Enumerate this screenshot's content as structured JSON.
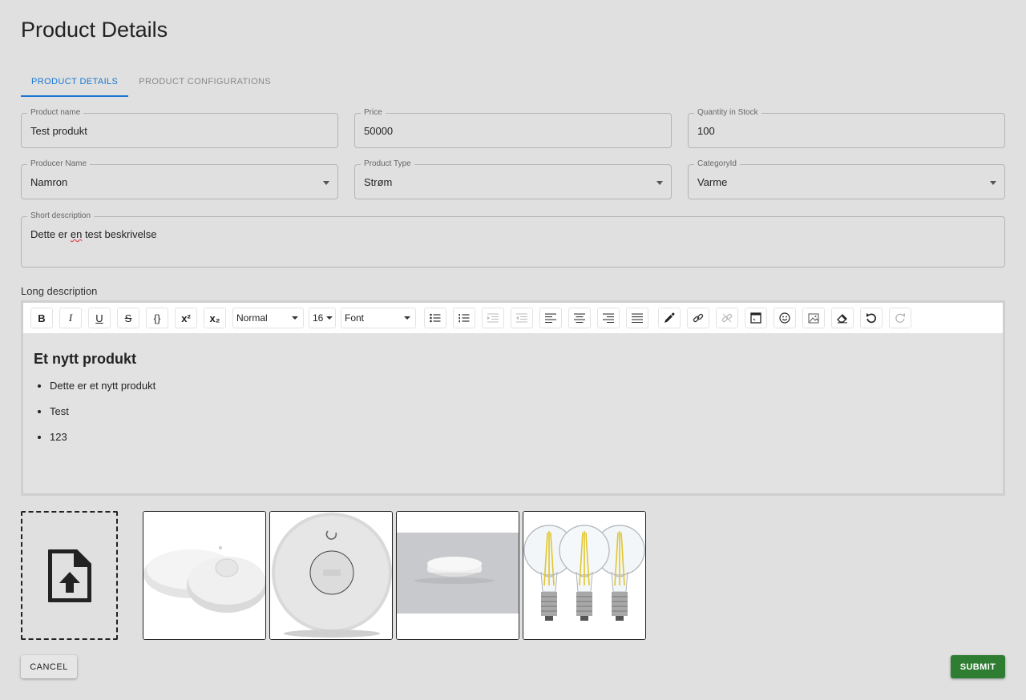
{
  "page": {
    "title": "Product Details"
  },
  "tabs": [
    {
      "label": "PRODUCT DETAILS"
    },
    {
      "label": "PRODUCT CONFIGURATIONS"
    }
  ],
  "fields": {
    "product_name": {
      "label": "Product name",
      "value": "Test produkt"
    },
    "price": {
      "label": "Price",
      "value": "50000"
    },
    "quantity": {
      "label": "Quantity in Stock",
      "value": "100"
    },
    "producer": {
      "label": "Producer Name",
      "value": "Namron"
    },
    "product_type": {
      "label": "Product Type",
      "value": "Strøm"
    },
    "category": {
      "label": "CategoryId",
      "value": "Varme"
    },
    "short_description": {
      "label": "Short description",
      "value_pre": "Dette er ",
      "value_flag": "en",
      "value_post": " test beskrivelse"
    }
  },
  "long_description": {
    "label": "Long description",
    "toolbar": {
      "bold": "B",
      "italic": "I",
      "underline": "U",
      "strike": "S",
      "code": "{}",
      "superscript": "x²",
      "subscript": "x₂",
      "block_type": "Normal",
      "font_size": "16",
      "font_family": "Font"
    },
    "content": {
      "heading": "Et nytt produkt",
      "items": [
        "Dette er et nytt produkt",
        "Test",
        "123"
      ]
    }
  },
  "images": {
    "icons": [
      "file-upload-icon"
    ],
    "thumbnails": [
      "smoke-detectors-pair",
      "smoke-detector-top",
      "smoke-detector-ceiling",
      "led-bulbs-three"
    ]
  },
  "actions": {
    "cancel": "CANCEL",
    "submit": "SUBMIT"
  },
  "colors": {
    "accent": "#1976d2",
    "submit": "#2e7d32",
    "background": "#e0e0e0"
  }
}
